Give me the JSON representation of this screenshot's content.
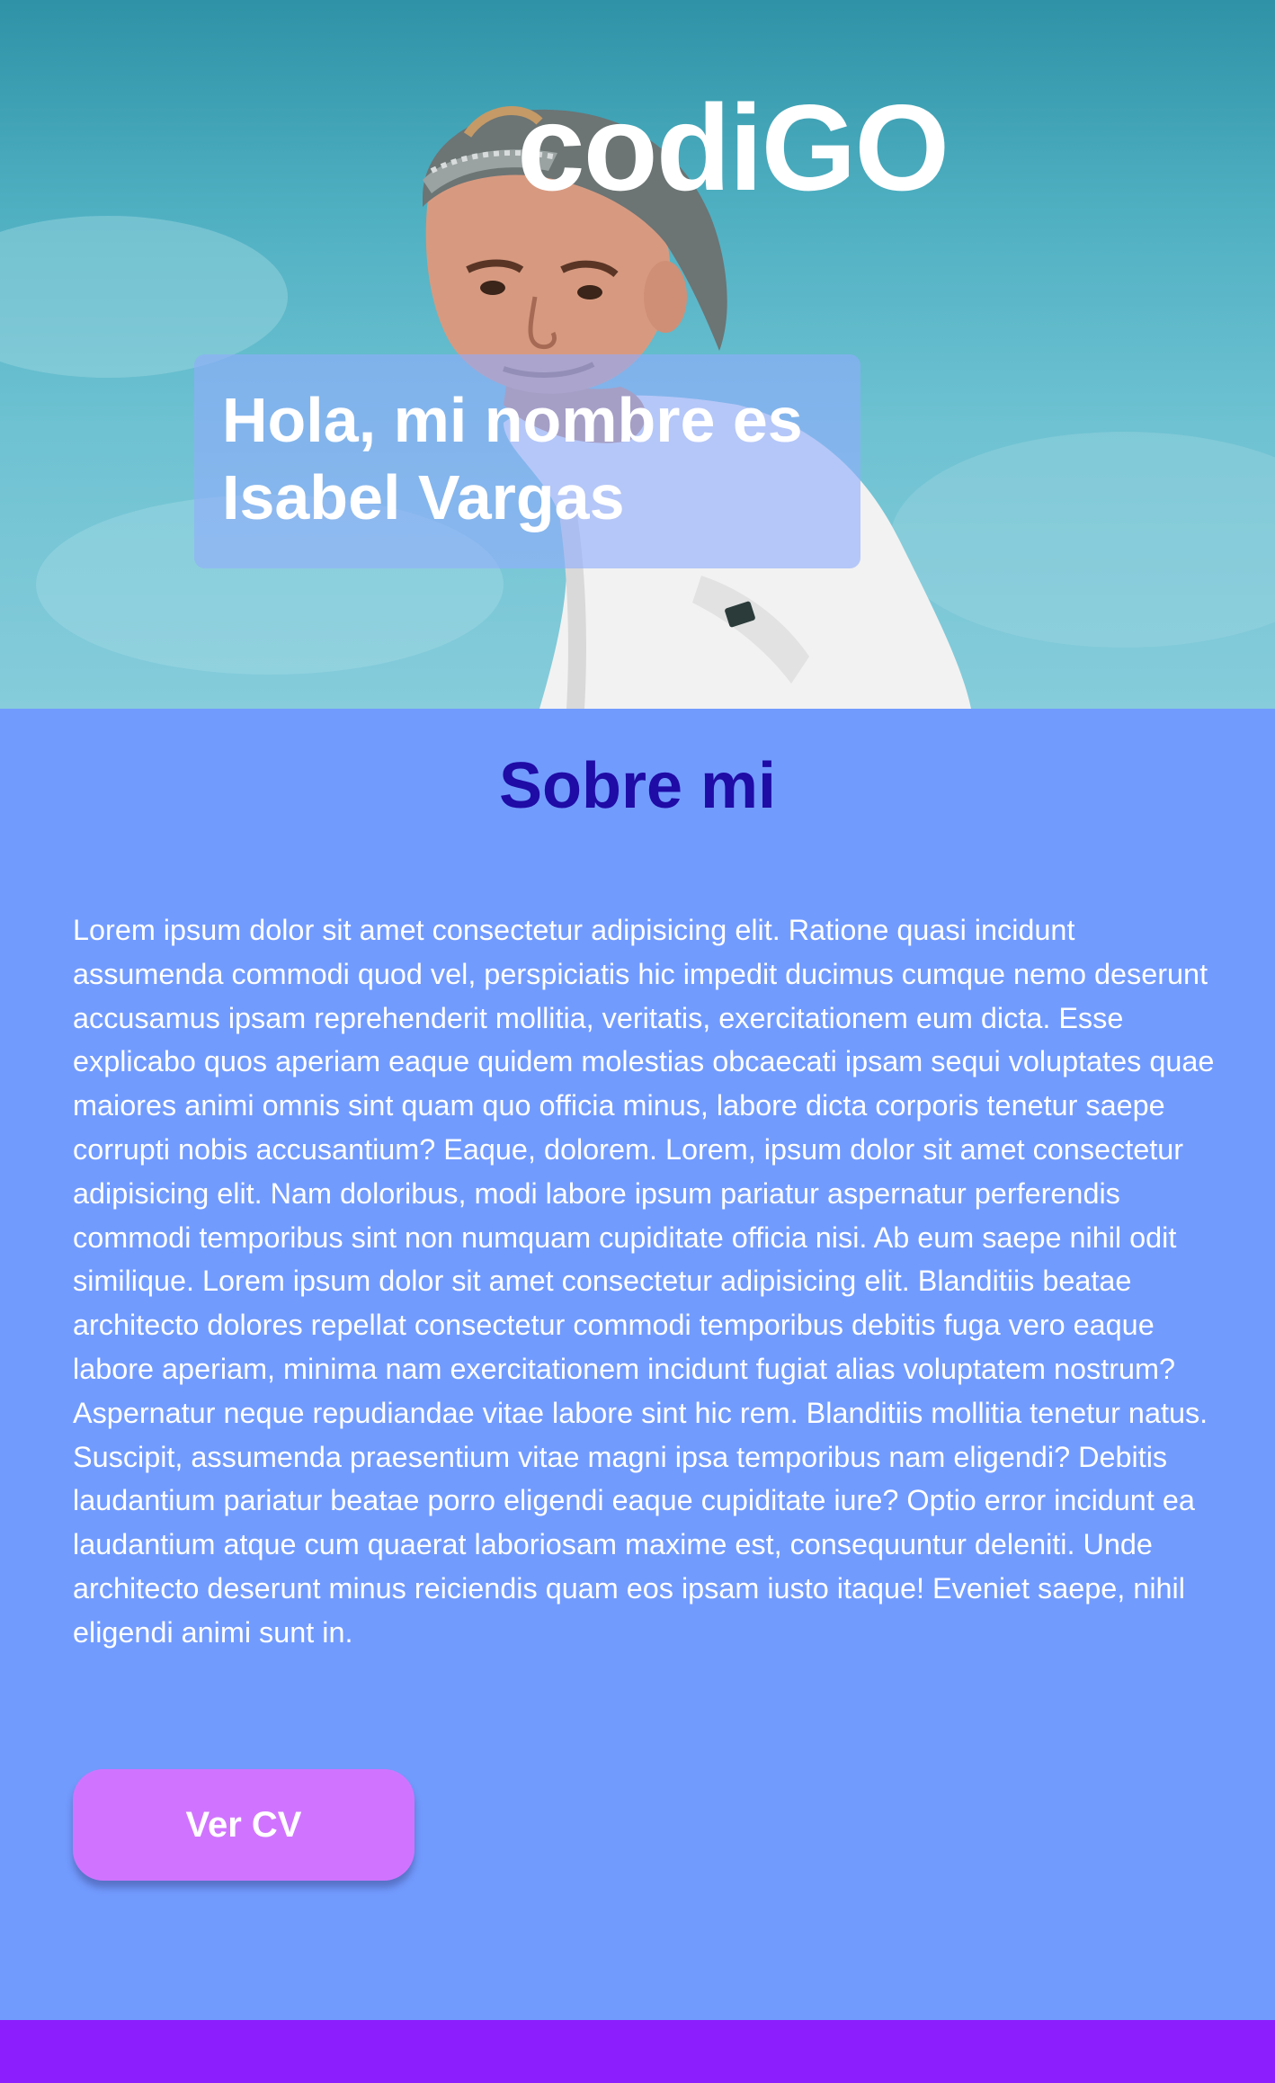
{
  "header": {
    "logo": "codiGO"
  },
  "hero": {
    "greeting": "Hola, mi nombre es Isabel Vargas"
  },
  "about": {
    "title": "Sobre mi",
    "body": "Lorem ipsum dolor sit amet consectetur adipisicing elit. Ratione quasi incidunt assumenda commodi quod vel, perspiciatis hic impedit ducimus cumque nemo deserunt accusamus ipsam reprehenderit mollitia, veritatis, exercitationem eum dicta. Esse explicabo quos aperiam eaque quidem molestias obcaecati ipsam sequi voluptates quae maiores animi omnis sint quam quo officia minus, labore dicta corporis tenetur saepe corrupti nobis accusantium? Eaque, dolorem. Lorem, ipsum dolor sit amet consectetur adipisicing elit. Nam doloribus, modi labore ipsum pariatur aspernatur perferendis commodi temporibus sint non numquam cupiditate officia nisi. Ab eum saepe nihil odit similique. Lorem ipsum dolor sit amet consectetur adipisicing elit. Blanditiis beatae architecto dolores repellat consectetur commodi temporibus debitis fuga vero eaque labore aperiam, minima nam exercitationem incidunt fugiat alias voluptatem nostrum? Aspernatur neque repudiandae vitae labore sint hic rem. Blanditiis mollitia tenetur natus. Suscipit, assumenda praesentium vitae magni ipsa temporibus nam eligendi? Debitis laudantium pariatur beatae porro eligendi eaque cupiditate iure? Optio error incidunt ea laudantium atque cum quaerat laboriosam maxime est, consequuntur deleniti. Unde architecto deserunt minus reiciendis quam eos ipsam iusto itaque! Eveniet saepe, nihil eligendi animi sunt in.",
    "cv_button": "Ver CV"
  },
  "colors": {
    "page_background": "#729bfe",
    "about_title": "#1f0ba6",
    "button": "#d074ff",
    "footer": "#8c1efd"
  }
}
